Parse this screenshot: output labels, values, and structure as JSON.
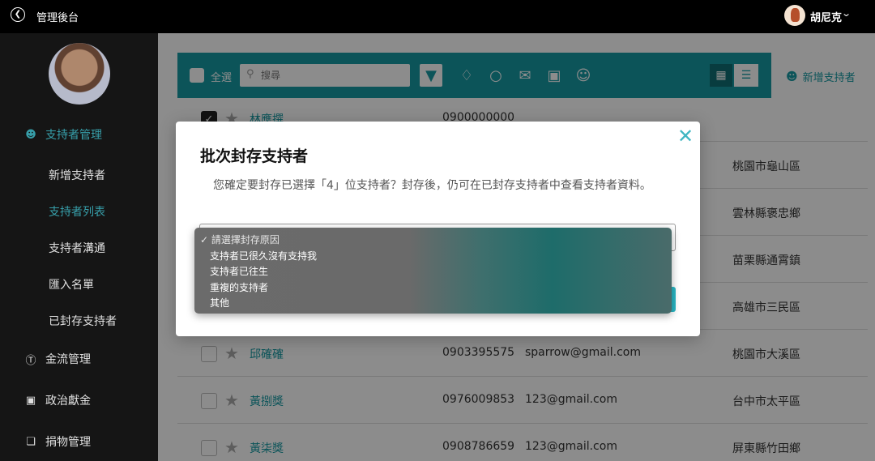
{
  "app": {
    "title": "管理後台",
    "user_name": "胡尼克"
  },
  "sidebar": {
    "sections": [
      {
        "label": "支持者管理",
        "icon": "user-icon",
        "active": true
      },
      {
        "label": "金流管理",
        "icon": "dollar-icon"
      },
      {
        "label": "政治獻金",
        "icon": "money-icon"
      },
      {
        "label": "捐物管理",
        "icon": "box-icon"
      }
    ],
    "sub_items": [
      "新增支持者",
      "支持者列表",
      "支持者溝通",
      "匯入名單",
      "已封存支持者"
    ],
    "active_sub": "支持者列表"
  },
  "toolbar": {
    "select_all_label": "全選",
    "search_placeholder": "搜尋",
    "add_supporter_label": "新增支持者"
  },
  "table": {
    "rows": [
      {
        "checked": true,
        "name": "林應撰",
        "phone": "0900000000",
        "email": "",
        "address": ""
      },
      {
        "checked": false,
        "name": "",
        "phone": "",
        "email": "",
        "address": "桃園市龜山區"
      },
      {
        "checked": false,
        "name": "",
        "phone": "",
        "email": "",
        "address": "雲林縣褒忠鄉"
      },
      {
        "checked": false,
        "name": "",
        "phone": "",
        "email": "",
        "address": "苗栗縣通霄鎮"
      },
      {
        "checked": false,
        "name": "",
        "phone": "",
        "email": "",
        "address": "高雄市三民區"
      },
      {
        "checked": false,
        "name": "邱確確",
        "phone": "0903395575",
        "email": "sparrow@gmail.com",
        "address": "桃園市大溪區"
      },
      {
        "checked": false,
        "name": "黃捌獎",
        "phone": "0976009853",
        "email": "123@gmail.com",
        "address": "台中市太平區"
      },
      {
        "checked": false,
        "name": "黃柒獎",
        "phone": "0908786659",
        "email": "123@gmail.com",
        "address": "屏東縣竹田鄉"
      }
    ]
  },
  "modal": {
    "title": "批次封存支持者",
    "description": "您確定要封存已選擇「4」位支持者？封存後，仍可在已封存支持者中查看支持者資料。",
    "select": {
      "placeholder": "請選擇封存原因",
      "options": [
        "支持者已很久沒有支持我",
        "支持者已往生",
        "重複的支持者",
        "其他"
      ]
    }
  },
  "colors": {
    "accent": "#169aa3",
    "active_nav": "#3fb6c2"
  }
}
